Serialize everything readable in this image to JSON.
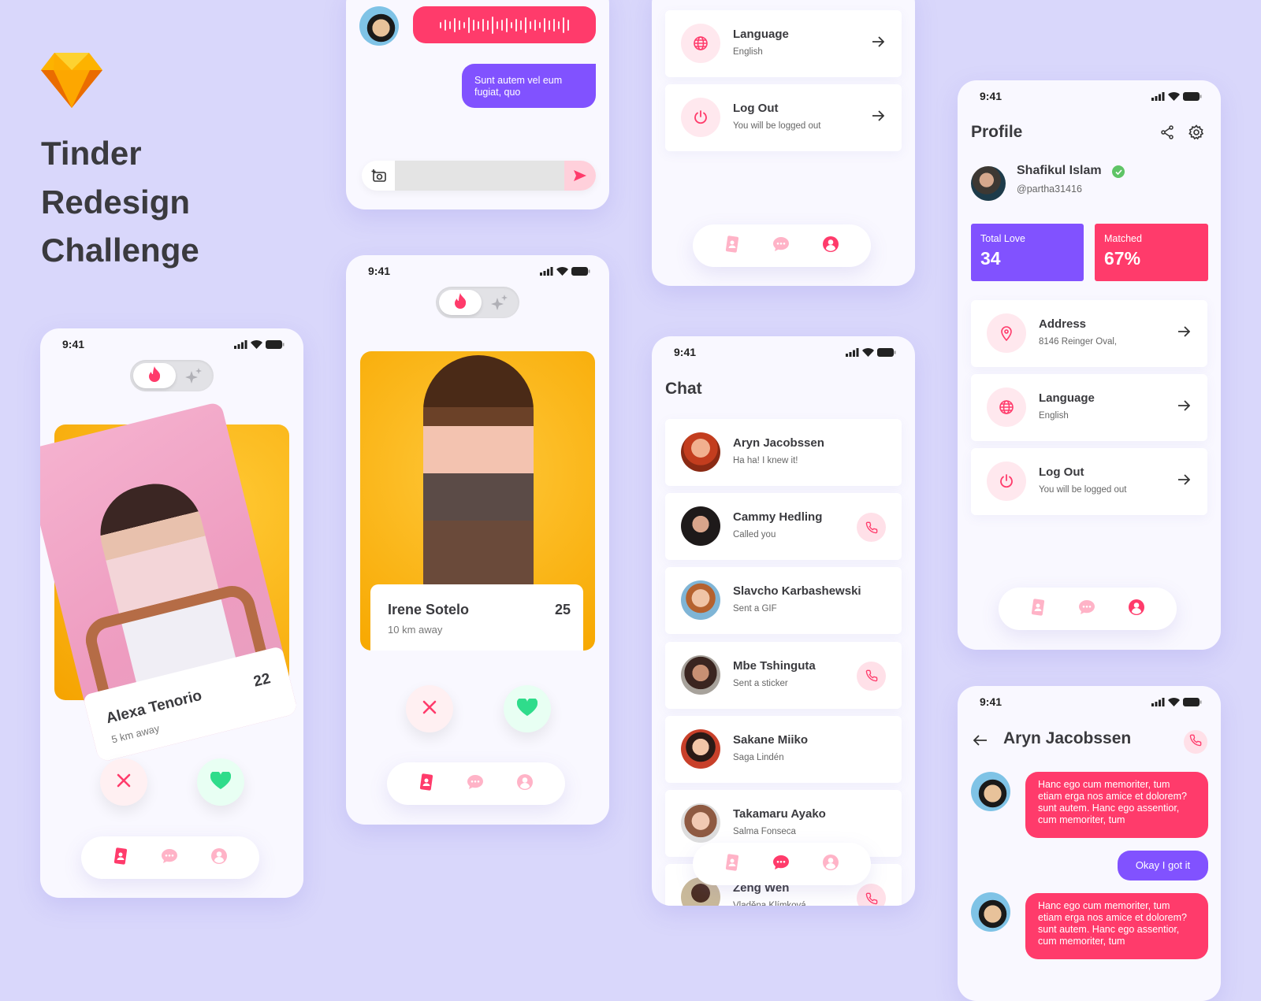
{
  "brand": {
    "logo_icon": "sketch-diamond-icon",
    "title_lines": [
      "Tinder",
      "Redesign",
      "Challenge"
    ]
  },
  "colors": {
    "pink": "#ff3b6b",
    "purple": "#8152ff",
    "background": "#d9d7fb",
    "green": "#2fdc8b"
  },
  "status": {
    "time": "9:41"
  },
  "swipe1": {
    "name": "Alexa Tenorio",
    "distance": "5 km away",
    "age": "22"
  },
  "swipe2": {
    "name": "Irene Sotelo",
    "distance": "10 km away",
    "age": "25"
  },
  "nav": {
    "items": [
      {
        "icon": "cards-icon"
      },
      {
        "icon": "chat-icon"
      },
      {
        "icon": "profile-icon"
      }
    ]
  },
  "chat_snippet": {
    "sent_message": "Sunt autem vel eum fugiat, quo",
    "input_placeholder": ""
  },
  "settings": {
    "items": [
      {
        "icon": "globe-icon",
        "title": "Language",
        "subtitle": "English"
      },
      {
        "icon": "power-icon",
        "title": "Log Out",
        "subtitle": "You will be logged out"
      }
    ]
  },
  "chat": {
    "title": "Chat",
    "items": [
      {
        "name": "Aryn Jacobssen",
        "message": "Ha ha! I knew it!",
        "call": false
      },
      {
        "name": "Cammy Hedling",
        "message": "Called you",
        "call": true
      },
      {
        "name": "Slavcho Karbashewski",
        "message": "Sent a GIF",
        "call": false
      },
      {
        "name": "Mbe Tshinguta",
        "message": "Sent a sticker",
        "call": true
      },
      {
        "name": "Sakane Miiko",
        "message": "Saga Lindén",
        "call": false
      },
      {
        "name": "Takamaru Ayako",
        "message": "Salma Fonseca",
        "call": false
      },
      {
        "name": "Zeng Wen",
        "message": "Vladěna Klímková",
        "call": true
      }
    ]
  },
  "profile": {
    "title": "Profile",
    "name": "Shafikul Islam",
    "handle": "@partha31416",
    "verified": true,
    "stats": [
      {
        "label": "Total Love",
        "value": "34"
      },
      {
        "label": "Matched",
        "value": "67%"
      }
    ],
    "items": [
      {
        "icon": "location-pin-icon",
        "title": "Address",
        "subtitle": "8146 Reinger Oval,"
      },
      {
        "icon": "globe-icon",
        "title": "Language",
        "subtitle": "English"
      },
      {
        "icon": "power-icon",
        "title": "Log Out",
        "subtitle": "You will be logged out"
      }
    ]
  },
  "conversation": {
    "title": "Aryn Jacobssen",
    "messages": [
      {
        "from": "them",
        "text": "Hanc ego cum memoriter, tum etiam erga nos amice et dolorem? sunt autem. Hanc ego assentior, cum memoriter, tum"
      },
      {
        "from": "me",
        "text": "Okay I got it"
      },
      {
        "from": "them",
        "text": "Hanc ego cum memoriter, tum etiam erga nos amice et dolorem? sunt autem. Hanc ego assentior, cum memoriter, tum"
      }
    ]
  }
}
